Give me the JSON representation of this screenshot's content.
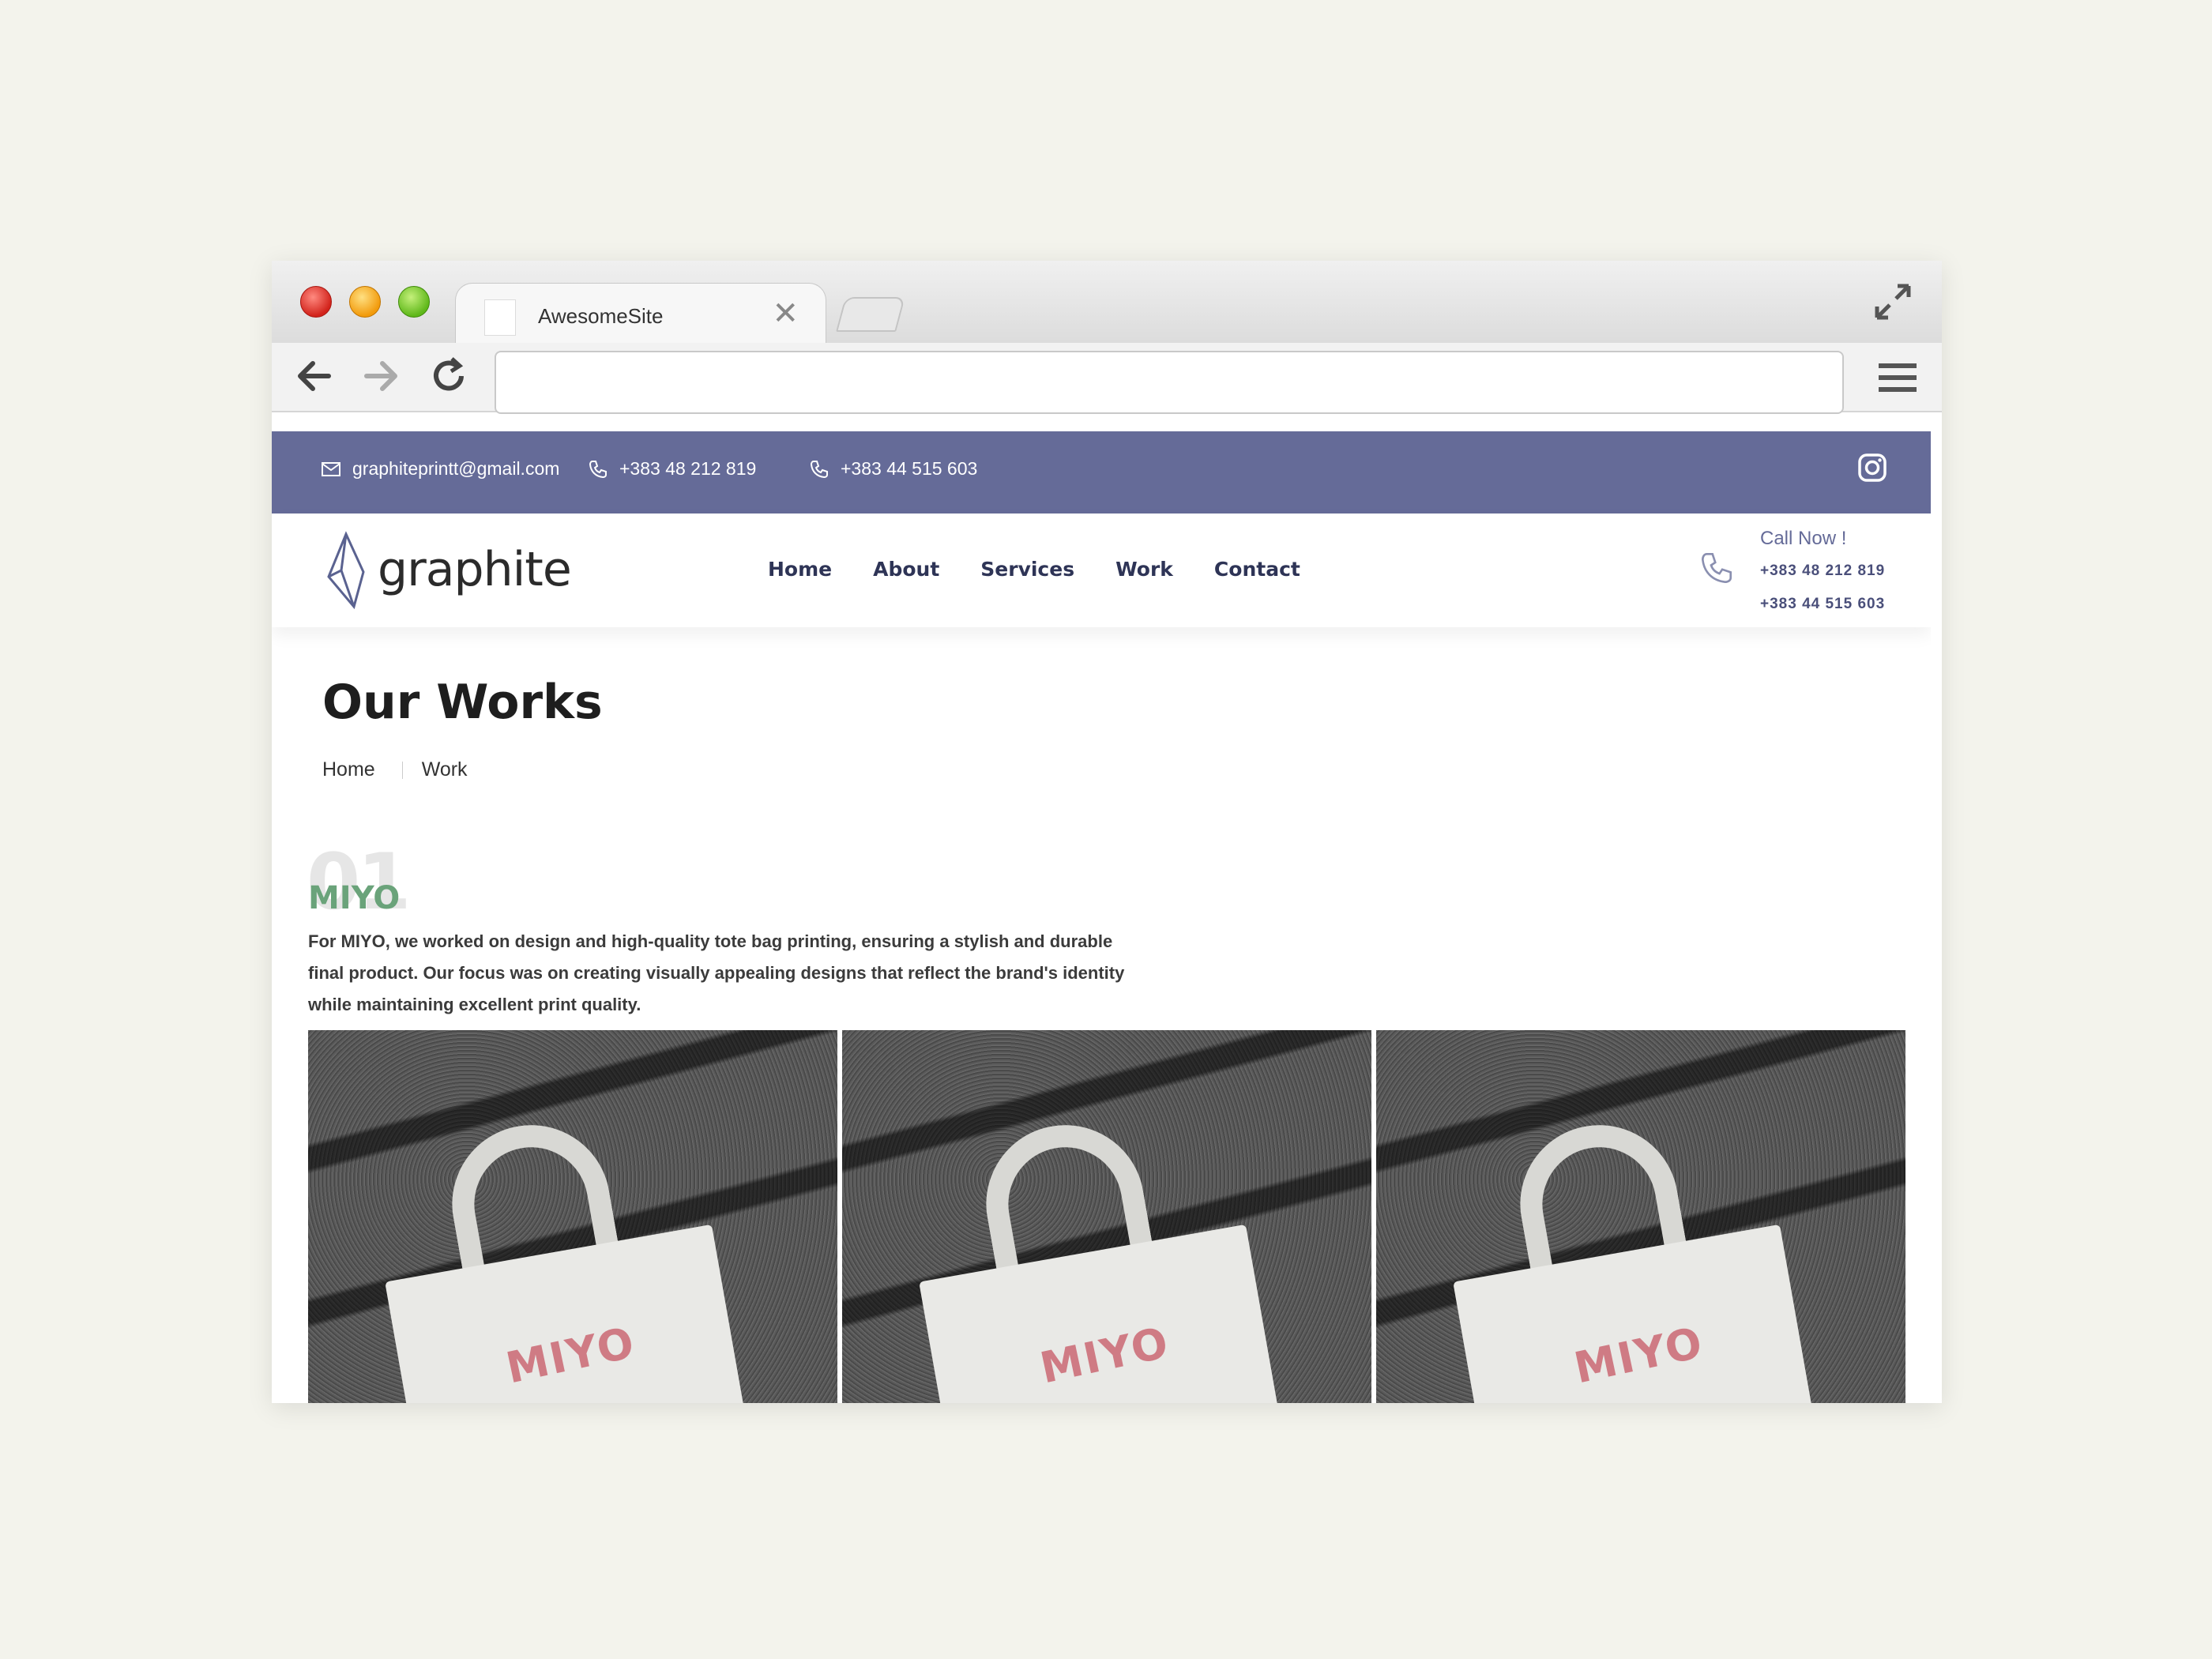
{
  "browser": {
    "tab_title": "AwesomeSite",
    "tab_close": "✕",
    "url": ""
  },
  "topbar": {
    "email": "graphiteprintt@gmail.com",
    "phone1": "+383 48 212 819",
    "phone2": "+383 44 515 603"
  },
  "header": {
    "logo_text": "graphite",
    "nav": [
      "Home",
      "About",
      "Services",
      "Work",
      "Contact"
    ],
    "call_label": "Call Now !",
    "call_numbers": [
      "+383 48 212 819",
      "+383 44 515 603"
    ]
  },
  "main": {
    "title": "Our Works",
    "breadcrumb": [
      "Home",
      "Work"
    ],
    "work": {
      "number": "01",
      "name": "MIYO",
      "description": "For MIYO, we worked on design and high-quality tote bag printing, ensuring a stylish and durable final product. Our focus was on creating visually appealing designs that reflect the brand's identity while maintaining excellent print quality.",
      "photo_label": "MIYO"
    }
  },
  "colors": {
    "topbar_bg": "#656b98",
    "nav_text": "#2e3456",
    "work_name": "#6aa37a",
    "page_bg": "#f3f3ec"
  },
  "icons": [
    "email-icon",
    "phone-icon",
    "instagram-icon",
    "back-arrow-icon",
    "forward-arrow-icon",
    "reload-icon",
    "hamburger-menu-icon",
    "expand-icon"
  ]
}
